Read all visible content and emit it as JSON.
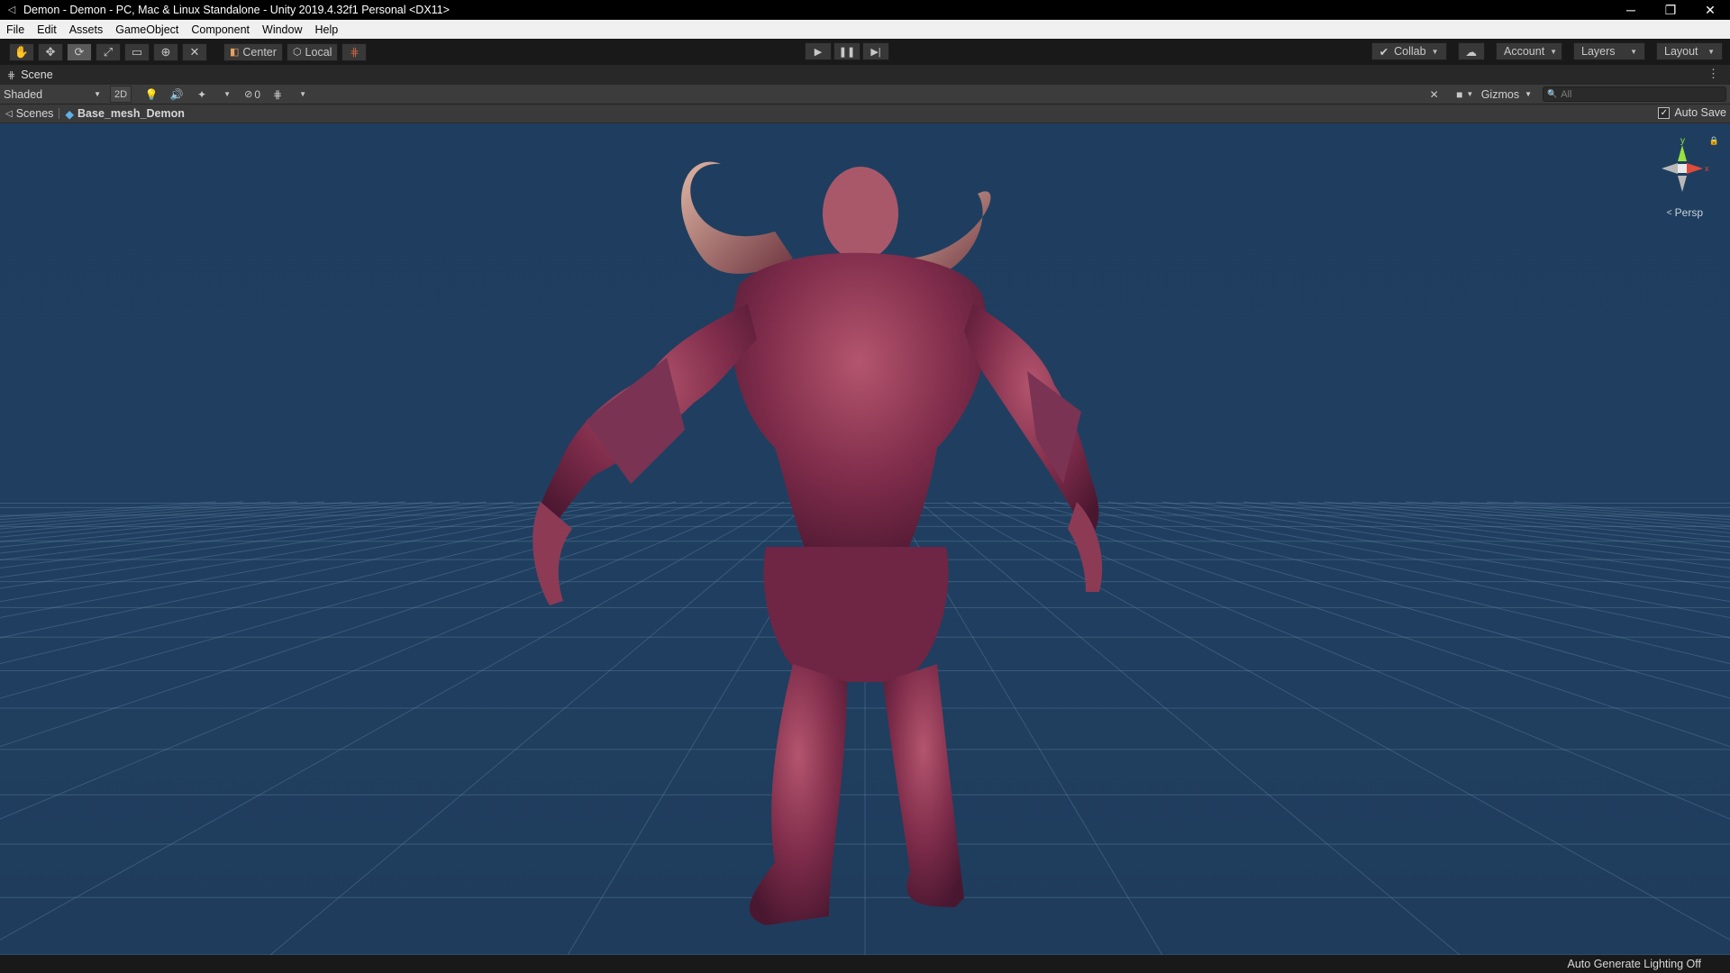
{
  "window": {
    "title": "Demon - Demon - PC, Mac & Linux Standalone - Unity 2019.4.32f1 Personal <DX11>",
    "app_icon": "unity-icon",
    "controls": [
      "minimize-icon",
      "restore-icon",
      "close-icon"
    ]
  },
  "menu": {
    "items": [
      "File",
      "Edit",
      "Assets",
      "GameObject",
      "Component",
      "Window",
      "Help"
    ]
  },
  "toolbar": {
    "tools": [
      {
        "name": "hand-tool",
        "glyph": "✋"
      },
      {
        "name": "move-tool",
        "glyph": "✥"
      },
      {
        "name": "rotate-tool",
        "glyph": "⟳"
      },
      {
        "name": "scale-tool",
        "glyph": "⤢"
      },
      {
        "name": "rect-tool",
        "glyph": "▭"
      },
      {
        "name": "transform-tool",
        "glyph": "⊕"
      },
      {
        "name": "custom-tool",
        "glyph": "✕"
      }
    ],
    "active_tool": "rotate-tool",
    "pivot_label": "Center",
    "rotation_label": "Local",
    "collab_label": "Collab",
    "account_label": "Account",
    "layers_label": "Layers",
    "layout_label": "Layout"
  },
  "scene_tab": {
    "label": "Scene"
  },
  "scene_toolbar": {
    "shading_mode": "Shaded",
    "mode_2d": "2D",
    "hidden_count": "0",
    "gizmos_label": "Gizmos",
    "search_placeholder": "All"
  },
  "breadcrumb": {
    "scenes_label": "Scenes",
    "prefab_label": "Base_mesh_Demon",
    "auto_save_label": "Auto Save",
    "auto_save_checked": true
  },
  "viewport": {
    "orientation_label": "Persp",
    "axis_labels": {
      "y": "y",
      "x": "x"
    },
    "subject": "demon-model",
    "colors": {
      "sky": "#1f3e5f",
      "grid": "#5d7ea0",
      "skin": "#8a3050"
    }
  },
  "status": {
    "text": "Auto Generate Lighting Off"
  }
}
